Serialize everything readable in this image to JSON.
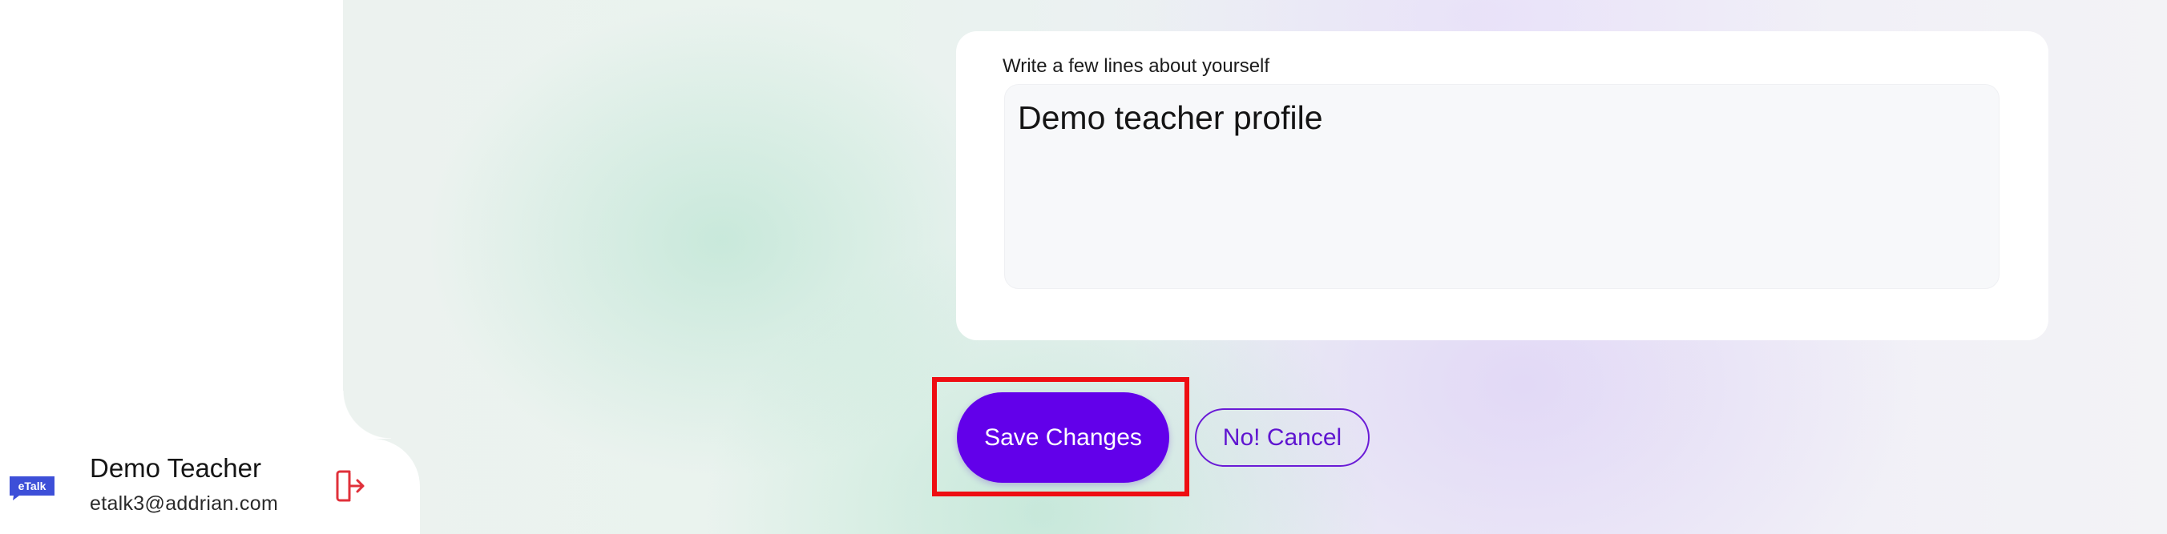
{
  "sidebar": {
    "logo_text": "eTalk",
    "user": {
      "name": "Demo Teacher",
      "email": "etalk3@addrian.com"
    },
    "logout_icon": "logout-icon"
  },
  "profile_form": {
    "bio_label": "Write a few lines about yourself",
    "bio_value": "Demo teacher profile"
  },
  "actions": {
    "save_label": "Save Changes",
    "cancel_label": "No! Cancel"
  },
  "colors": {
    "primary": "#6200ea",
    "highlight": "#ee0d12",
    "logout": "#e0303a",
    "logo": "#3d4fd8"
  }
}
